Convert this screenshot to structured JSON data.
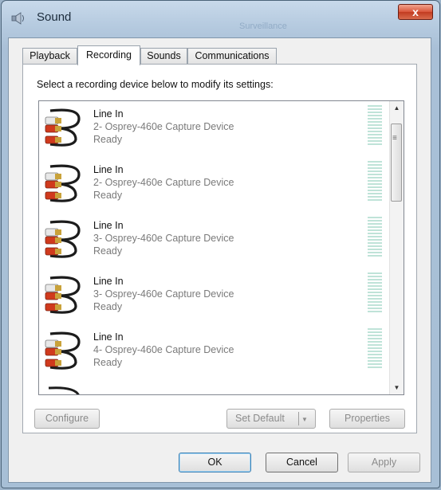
{
  "window": {
    "title": "Sound",
    "close_label": "x",
    "background_title_text": "Surveillance"
  },
  "tabs": [
    {
      "label": "Playback",
      "active": false
    },
    {
      "label": "Recording",
      "active": true
    },
    {
      "label": "Sounds",
      "active": false
    },
    {
      "label": "Communications",
      "active": false
    }
  ],
  "instruction": "Select a recording device below to modify its settings:",
  "devices": [
    {
      "name": "Line In",
      "description": "2- Osprey-460e Capture Device",
      "status": "Ready"
    },
    {
      "name": "Line In",
      "description": "2- Osprey-460e Capture Device",
      "status": "Ready"
    },
    {
      "name": "Line In",
      "description": "3- Osprey-460e Capture Device",
      "status": "Ready"
    },
    {
      "name": "Line In",
      "description": "3- Osprey-460e Capture Device",
      "status": "Ready"
    },
    {
      "name": "Line In",
      "description": "4- Osprey-460e Capture Device",
      "status": "Ready"
    }
  ],
  "buttons": {
    "configure": "Configure",
    "set_default": "Set Default",
    "properties": "Properties",
    "ok": "OK",
    "cancel": "Cancel",
    "apply": "Apply"
  },
  "colors": {
    "meter": "#bfe3d8",
    "close_button": "#d9553a",
    "frame": "#a9c0d7"
  },
  "icons": {
    "title": "speaker-icon",
    "device": "rca-cable-icon"
  }
}
